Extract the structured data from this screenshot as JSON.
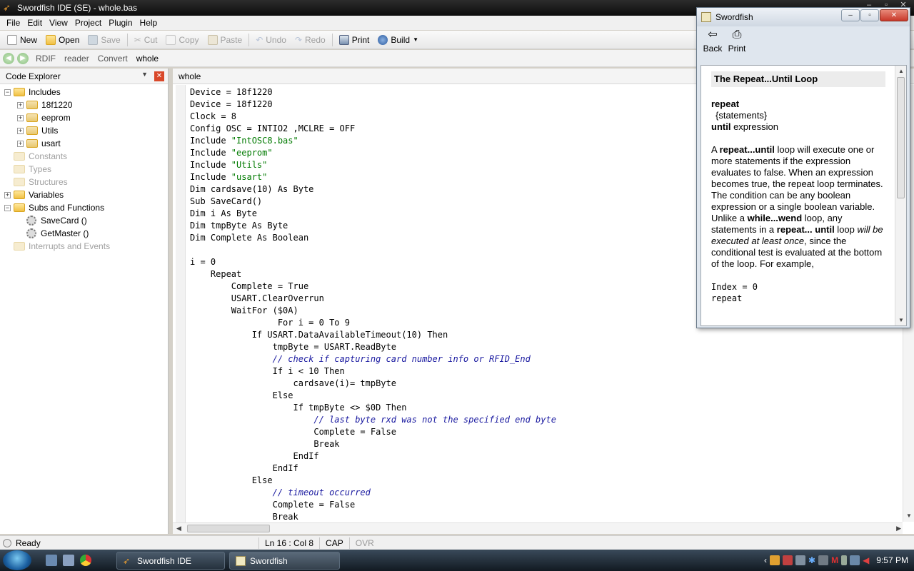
{
  "window": {
    "title": "Swordfish IDE (SE) - whole.bas"
  },
  "menu": [
    "File",
    "Edit",
    "View",
    "Project",
    "Plugin",
    "Help"
  ],
  "toolbar": {
    "new": "New",
    "open": "Open",
    "save": "Save",
    "cut": "Cut",
    "copy": "Copy",
    "paste": "Paste",
    "undo": "Undo",
    "redo": "Redo",
    "print": "Print",
    "build": "Build"
  },
  "navbar": {
    "links": [
      "RDIF",
      "reader",
      "Convert",
      "whole"
    ]
  },
  "explorer": {
    "title": "Code Explorer",
    "items": [
      {
        "label": "Includes",
        "level": 0,
        "expander": "−",
        "dim": false,
        "icon": "folder"
      },
      {
        "label": "18f1220",
        "level": 1,
        "expander": "+",
        "dim": false,
        "icon": "folder-grid"
      },
      {
        "label": "eeprom",
        "level": 1,
        "expander": "+",
        "dim": false,
        "icon": "folder-grid"
      },
      {
        "label": "Utils",
        "level": 1,
        "expander": "+",
        "dim": false,
        "icon": "folder-grid"
      },
      {
        "label": "usart",
        "level": 1,
        "expander": "+",
        "dim": false,
        "icon": "folder-grid"
      },
      {
        "label": "Constants",
        "level": 0,
        "expander": "",
        "dim": true,
        "icon": "folder"
      },
      {
        "label": "Types",
        "level": 0,
        "expander": "",
        "dim": true,
        "icon": "folder"
      },
      {
        "label": "Structures",
        "level": 0,
        "expander": "",
        "dim": true,
        "icon": "folder"
      },
      {
        "label": "Variables",
        "level": 0,
        "expander": "+",
        "dim": false,
        "icon": "folder"
      },
      {
        "label": "Subs and Functions",
        "level": 0,
        "expander": "−",
        "dim": false,
        "icon": "folder"
      },
      {
        "label": "SaveCard ()",
        "level": 1,
        "expander": "",
        "dim": false,
        "icon": "gear"
      },
      {
        "label": "GetMaster ()",
        "level": 1,
        "expander": "",
        "dim": false,
        "icon": "gear"
      },
      {
        "label": "Interrupts and Events",
        "level": 0,
        "expander": "",
        "dim": true,
        "icon": "folder"
      }
    ]
  },
  "editor": {
    "tab": "whole",
    "lines": [
      [
        [
          "Device = 18f1220",
          ""
        ]
      ],
      [
        [
          "Device = 18f1220",
          ""
        ]
      ],
      [
        [
          "Clock = 8",
          ""
        ]
      ],
      [
        [
          "Config OSC = INTIO2 ,MCLRE = OFF",
          ""
        ]
      ],
      [
        [
          "Include ",
          ""
        ],
        [
          "\"IntOSC8.bas\"",
          "str"
        ]
      ],
      [
        [
          "Include ",
          ""
        ],
        [
          "\"eeprom\"",
          "str"
        ]
      ],
      [
        [
          "Include ",
          ""
        ],
        [
          "\"Utils\"",
          "str"
        ]
      ],
      [
        [
          "Include ",
          ""
        ],
        [
          "\"usart\"",
          "str"
        ]
      ],
      [
        [
          "Dim cardsave(10) As Byte",
          ""
        ]
      ],
      [
        [
          "Sub SaveCard()",
          ""
        ]
      ],
      [
        [
          "Dim i As Byte",
          ""
        ]
      ],
      [
        [
          "Dim tmpByte As Byte",
          ""
        ]
      ],
      [
        [
          "Dim Complete As Boolean",
          ""
        ]
      ],
      [
        [
          "",
          ""
        ]
      ],
      [
        [
          "i = 0",
          ""
        ]
      ],
      [
        [
          "    Repeat",
          ""
        ]
      ],
      [
        [
          "        Complete = True",
          ""
        ]
      ],
      [
        [
          "        USART.ClearOverrun",
          ""
        ]
      ],
      [
        [
          "        WaitFor ($0A)",
          ""
        ]
      ],
      [
        [
          "                 For i = 0 To 9",
          ""
        ]
      ],
      [
        [
          "            If USART.DataAvailableTimeout(10) Then",
          ""
        ]
      ],
      [
        [
          "                tmpByte = USART.ReadByte",
          ""
        ]
      ],
      [
        [
          "                ",
          ""
        ],
        [
          "// check if capturing card number info or RFID_End",
          "cmt"
        ]
      ],
      [
        [
          "                If i < 10 Then",
          ""
        ]
      ],
      [
        [
          "                    cardsave(i)= tmpByte",
          ""
        ]
      ],
      [
        [
          "                Else",
          ""
        ]
      ],
      [
        [
          "                    If tmpByte <> $0D Then",
          ""
        ]
      ],
      [
        [
          "                        ",
          ""
        ],
        [
          "// last byte rxd was not the specified end byte",
          "cmt"
        ]
      ],
      [
        [
          "                        Complete = False",
          ""
        ]
      ],
      [
        [
          "                        Break",
          ""
        ]
      ],
      [
        [
          "                    EndIf",
          ""
        ]
      ],
      [
        [
          "                EndIf",
          ""
        ]
      ],
      [
        [
          "            Else",
          ""
        ]
      ],
      [
        [
          "                ",
          ""
        ],
        [
          "// timeout occurred",
          "cmt"
        ]
      ],
      [
        [
          "                Complete = False",
          ""
        ]
      ],
      [
        [
          "                Break",
          ""
        ]
      ]
    ]
  },
  "status": {
    "ready": "Ready",
    "position": "Ln 16 : Col 8",
    "cap": "CAP",
    "ovr": "OVR"
  },
  "taskbar": {
    "task1": "Swordfish IDE",
    "task2": "Swordfish",
    "clock": "9:57 PM"
  },
  "help": {
    "title": "Swordfish",
    "back": "Back",
    "print": "Print",
    "heading": "The Repeat...Until Loop",
    "syntax": [
      "repeat",
      "{statements}",
      "until",
      "expression"
    ],
    "para": [
      [
        "A ",
        ""
      ],
      [
        "repeat...until",
        "b"
      ],
      [
        " loop will execute one or more statements if the expression evaluates to false. When an expression becomes true, the repeat loop terminates. The condition can be any boolean expression or a single boolean variable. Unlike a ",
        ""
      ],
      [
        "while...wend",
        "b"
      ],
      [
        " loop, any statements in a ",
        ""
      ],
      [
        "repeat... until",
        "b"
      ],
      [
        " loop ",
        ""
      ],
      [
        "will be executed at least once",
        "i"
      ],
      [
        ", since the conditional test is evaluated at the bottom of the loop. For example,",
        ""
      ]
    ],
    "example": [
      "Index = 0",
      "repeat"
    ]
  }
}
